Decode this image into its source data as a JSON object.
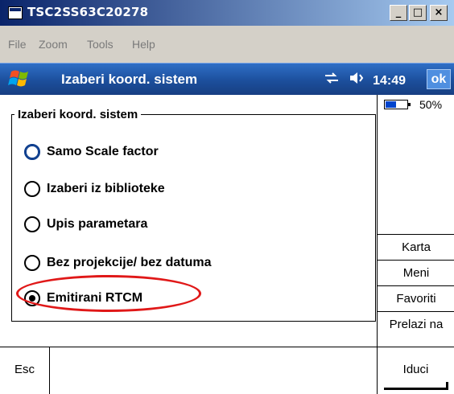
{
  "window": {
    "title": "TSC2SS63C20278",
    "controls": [
      "_",
      "□",
      "×"
    ]
  },
  "menubar": {
    "items": [
      "File",
      "Zoom",
      "Tools",
      "Help"
    ]
  },
  "pda": {
    "title": "Izaberi koord. sistem",
    "status_icons": [
      "sync-icon",
      "speaker-icon"
    ],
    "time": "14:49",
    "ok_label": "ok",
    "accent_color": "#1c4f9c"
  },
  "group": {
    "legend": "Izaberi koord. sistem",
    "options": [
      {
        "label": "Samo Scale factor",
        "checked": false,
        "focused": true
      },
      {
        "label": "Izaberi iz biblioteke",
        "checked": false,
        "focused": false
      },
      {
        "label": "Upis parametara",
        "checked": false,
        "focused": false
      },
      {
        "label": "Bez projekcije/ bez datuma",
        "checked": false,
        "focused": false
      },
      {
        "label": "Emitirani RTCM",
        "checked": true,
        "focused": false
      }
    ],
    "highlight_color": "#e01818"
  },
  "side": {
    "battery_text": "50%",
    "battery_level": 0.5,
    "buttons": [
      "Karta",
      "Meni",
      "Favoriti",
      "Prelazi na"
    ]
  },
  "bottom": {
    "esc_label": "Esc",
    "iduci_label": "Iduci"
  }
}
